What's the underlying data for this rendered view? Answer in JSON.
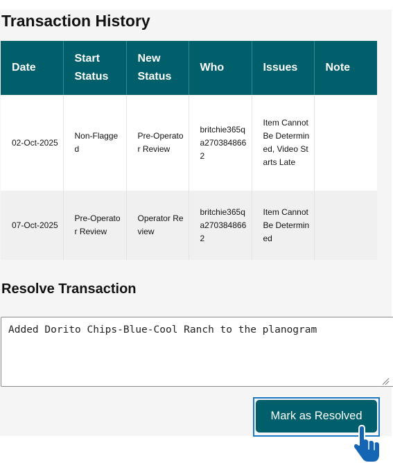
{
  "history": {
    "title": "Transaction History",
    "columns": [
      "Date",
      "Start Status",
      "New Status",
      "Who",
      "Issues",
      "Note"
    ],
    "rows": [
      {
        "date": "02-Oct-2025",
        "start_status": "Non-Flagged",
        "new_status": "Pre-Operator Review",
        "who": "britchie365qa2703848662",
        "issues": "Item Cannot Be Determined, Video Starts Late",
        "note": ""
      },
      {
        "date": "07-Oct-2025",
        "start_status": "Pre-Operator Review",
        "new_status": "Operator Review",
        "who": "britchie365qa2703848662",
        "issues": "Item Cannot Be Determined",
        "note": ""
      }
    ]
  },
  "resolve": {
    "title": "Resolve Transaction",
    "note_value": "Added Dorito Chips-Blue-Cool Ranch to the planogram",
    "button_label": "Mark as Resolved"
  },
  "colors": {
    "header_bg": "#005f6b",
    "button_bg": "#005f6b",
    "highlight_border": "#1e78c8",
    "cursor_fill": "#1565b5"
  },
  "icons": {
    "cursor": "pointing-hand-cursor-icon",
    "resize": "resize-grip-icon"
  }
}
